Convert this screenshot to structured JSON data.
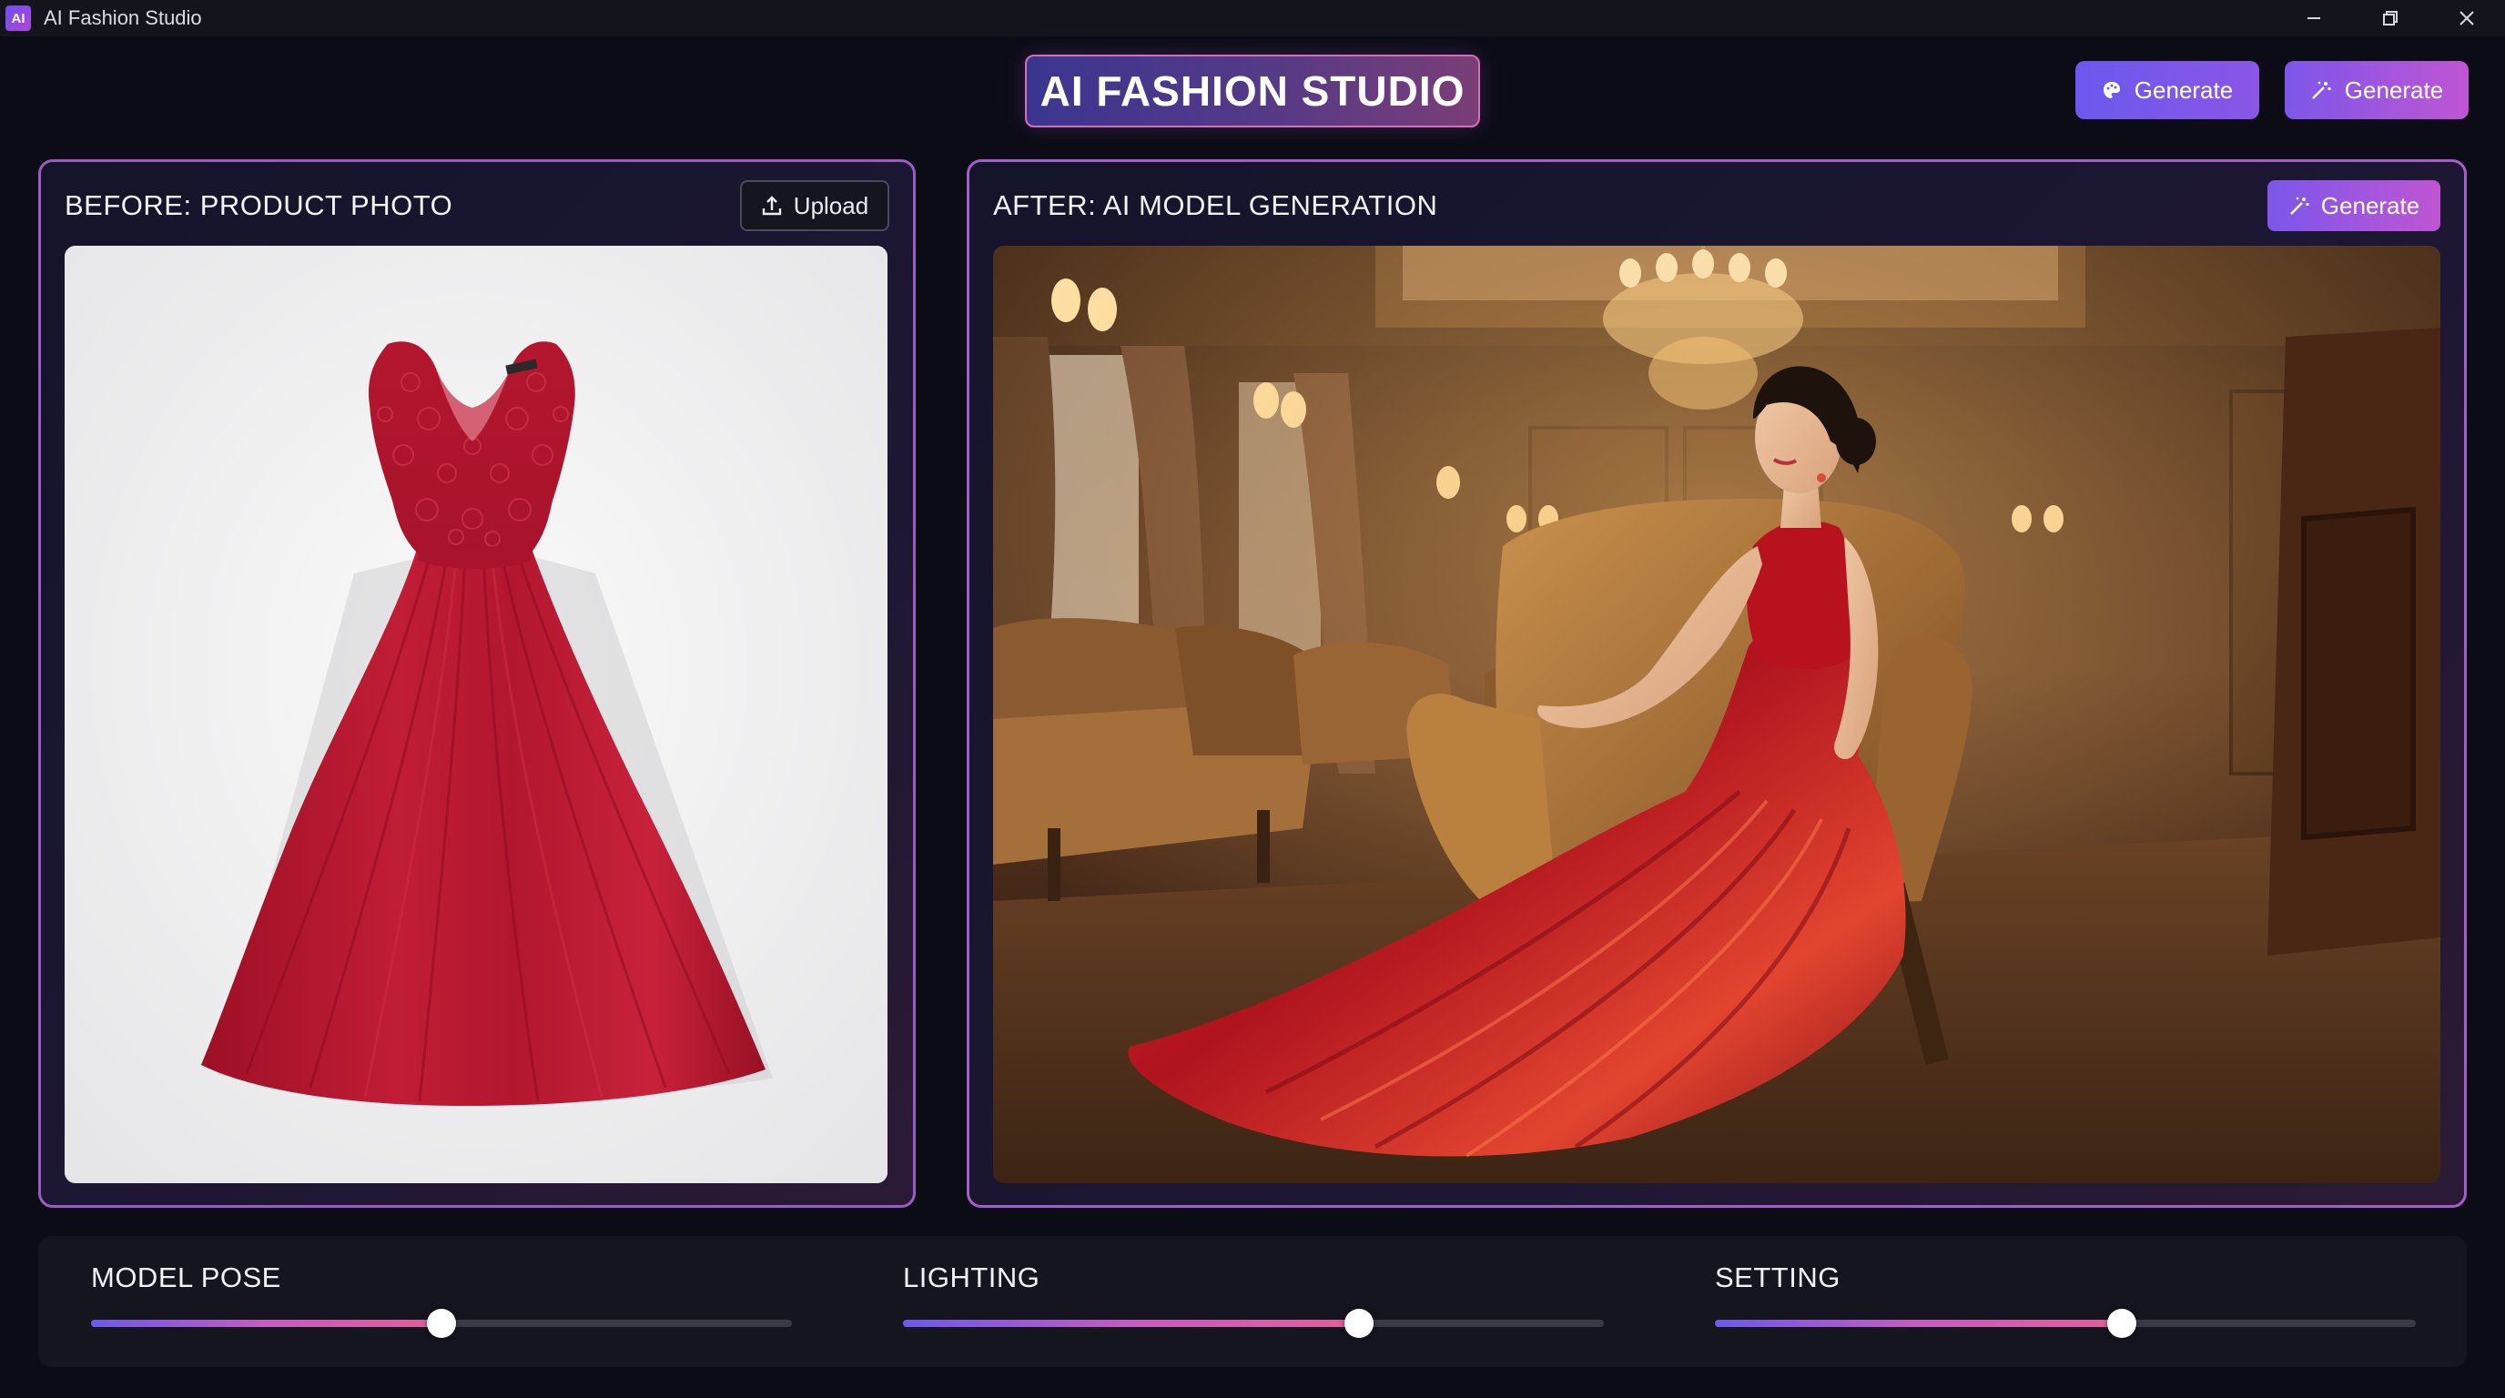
{
  "window": {
    "logo_text": "AI",
    "title": "AI Fashion Studio",
    "controls": [
      "minimize-icon",
      "restore-icon",
      "close-icon"
    ]
  },
  "header": {
    "brand": "AI FASHION STUDIO",
    "buttons": [
      {
        "label": "Generate",
        "icon": "palette-icon"
      },
      {
        "label": "Generate",
        "icon": "magic-wand-icon"
      }
    ]
  },
  "before_panel": {
    "title": "BEFORE: PRODUCT PHOTO",
    "upload_label": "Upload",
    "upload_icon": "upload-icon",
    "image": "red lace dress product photo"
  },
  "after_panel": {
    "title": "AFTER: AI MODEL GENERATION",
    "generate_label": "Generate",
    "generate_icon": "magic-wand-icon",
    "image": "model in red dress seated in armchair"
  },
  "controls": [
    {
      "label": "MODEL POSE",
      "value": 0.5
    },
    {
      "label": "LIGHTING",
      "value": 0.65
    },
    {
      "label": "SETTING",
      "value": 0.58
    }
  ],
  "colors": {
    "accent_start": "#6b5ae8",
    "accent_end": "#e05f97",
    "background": "#0c0c17",
    "dress_red": "#b3172f"
  }
}
